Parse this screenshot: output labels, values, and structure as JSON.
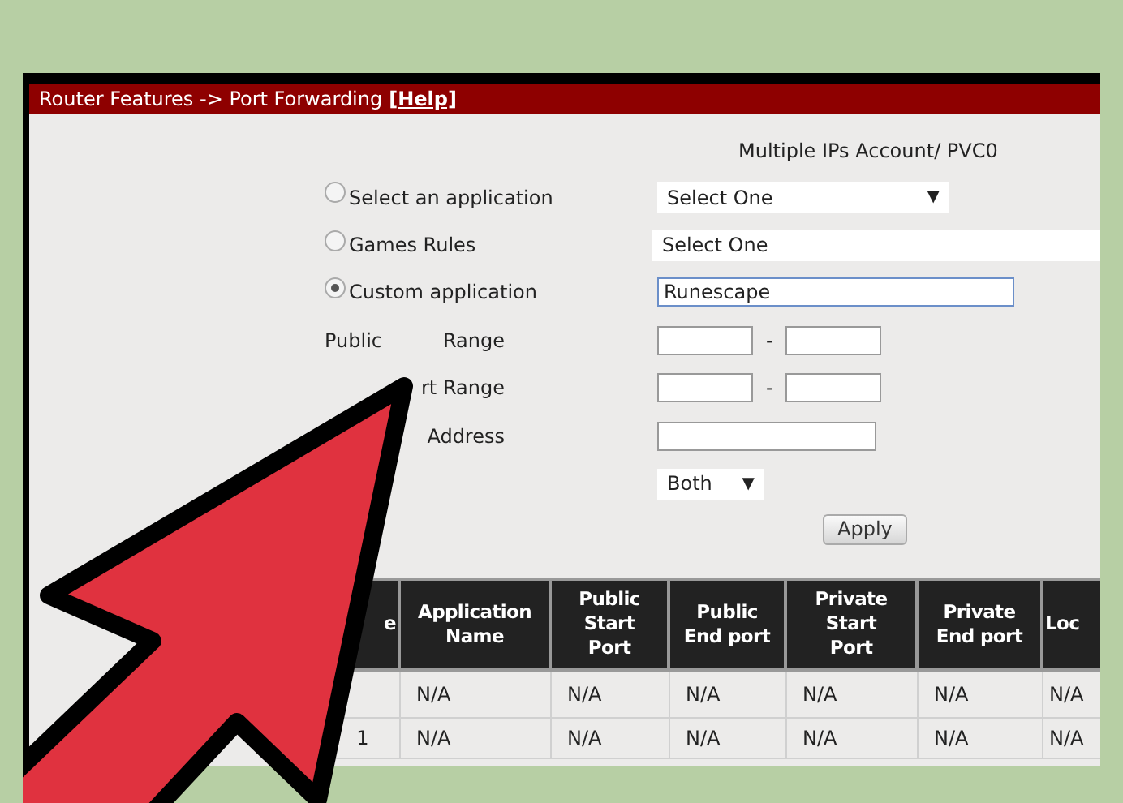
{
  "header": {
    "title": "Router Features -> Port Forwarding",
    "help_link": "[Help]"
  },
  "account": "Multiple IPs Account/ PVC0",
  "form_rows": [
    {
      "kind": "radio",
      "label": "Select an application",
      "selected": false,
      "field": {
        "kind": "select",
        "value": "Select One",
        "arrow": "▼"
      }
    },
    {
      "kind": "radio",
      "label": "Games Rules",
      "selected": false,
      "field": {
        "kind": "select",
        "value": "Select One"
      }
    },
    {
      "kind": "radio",
      "label": "Custom application",
      "selected": true,
      "field": {
        "kind": "text",
        "value": "Runescape",
        "focused": true
      }
    },
    {
      "kind": "range",
      "parts": [
        "Public",
        "Range"
      ],
      "separator": "-"
    },
    {
      "kind": "range",
      "parts": [
        "rt Range"
      ],
      "separator": "-"
    },
    {
      "kind": "text",
      "parts": [
        "Address"
      ],
      "focused": false
    },
    {
      "kind": "select",
      "field": {
        "kind": "select",
        "value": "Both",
        "arrow": "▼"
      }
    }
  ],
  "apply_button": "Apply",
  "table": {
    "columns": [
      {
        "lines": [
          "e"
        ]
      },
      {
        "lines": [
          "Application",
          "Name"
        ]
      },
      {
        "lines": [
          "Public",
          "Start",
          "Port"
        ]
      },
      {
        "lines": [
          "Public",
          "End port"
        ]
      },
      {
        "lines": [
          "Private",
          "Start",
          "Port"
        ]
      },
      {
        "lines": [
          "Private",
          "End port"
        ]
      },
      {
        "lines": [
          "Loc"
        ]
      }
    ],
    "rows": [
      {
        "cells": [
          "",
          "N/A",
          "N/A",
          "N/A",
          "N/A",
          "N/A",
          "N/A"
        ]
      },
      {
        "cells": [
          "1",
          "N/A",
          "N/A",
          "N/A",
          "N/A",
          "N/A",
          "N/A"
        ]
      }
    ]
  }
}
